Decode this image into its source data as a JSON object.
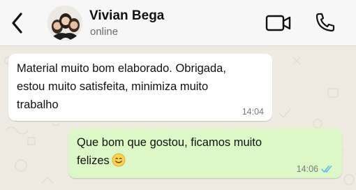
{
  "header": {
    "contact_name": "Vivian Bega",
    "contact_status": "online",
    "back_icon": "chevron-left-icon",
    "video_icon": "video-camera-icon",
    "call_icon": "phone-icon"
  },
  "messages": [
    {
      "direction": "incoming",
      "lines": [
        "Material muito bom elaborado. Obrigada,",
        "estou muito satisfeita, minimiza muito",
        "trabalho"
      ],
      "time": "14:04"
    },
    {
      "direction": "outgoing",
      "lines": [
        "Que bom que gostou, ficamos muito",
        "felizes"
      ],
      "emoji": "smiling-face-emoji",
      "time": "14:06",
      "status": "read-double-check"
    }
  ],
  "colors": {
    "incoming_bubble": "#ffffff",
    "outgoing_bubble": "#dcf8c6",
    "chat_background": "#efeae2",
    "read_ticks": "#53bdeb"
  }
}
